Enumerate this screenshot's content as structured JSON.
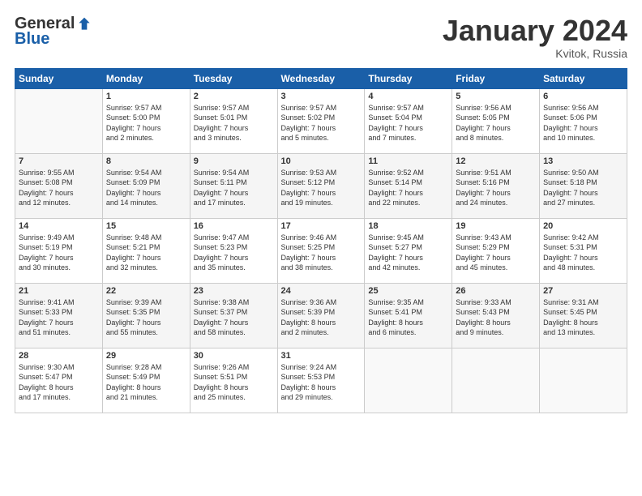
{
  "logo": {
    "general": "General",
    "blue": "Blue"
  },
  "title": {
    "month_year": "January 2024",
    "location": "Kvitok, Russia"
  },
  "headers": [
    "Sunday",
    "Monday",
    "Tuesday",
    "Wednesday",
    "Thursday",
    "Friday",
    "Saturday"
  ],
  "weeks": [
    [
      {
        "day": "",
        "info": ""
      },
      {
        "day": "1",
        "info": "Sunrise: 9:57 AM\nSunset: 5:00 PM\nDaylight: 7 hours\nand 2 minutes."
      },
      {
        "day": "2",
        "info": "Sunrise: 9:57 AM\nSunset: 5:01 PM\nDaylight: 7 hours\nand 3 minutes."
      },
      {
        "day": "3",
        "info": "Sunrise: 9:57 AM\nSunset: 5:02 PM\nDaylight: 7 hours\nand 5 minutes."
      },
      {
        "day": "4",
        "info": "Sunrise: 9:57 AM\nSunset: 5:04 PM\nDaylight: 7 hours\nand 7 minutes."
      },
      {
        "day": "5",
        "info": "Sunrise: 9:56 AM\nSunset: 5:05 PM\nDaylight: 7 hours\nand 8 minutes."
      },
      {
        "day": "6",
        "info": "Sunrise: 9:56 AM\nSunset: 5:06 PM\nDaylight: 7 hours\nand 10 minutes."
      }
    ],
    [
      {
        "day": "7",
        "info": "Sunrise: 9:55 AM\nSunset: 5:08 PM\nDaylight: 7 hours\nand 12 minutes."
      },
      {
        "day": "8",
        "info": "Sunrise: 9:54 AM\nSunset: 5:09 PM\nDaylight: 7 hours\nand 14 minutes."
      },
      {
        "day": "9",
        "info": "Sunrise: 9:54 AM\nSunset: 5:11 PM\nDaylight: 7 hours\nand 17 minutes."
      },
      {
        "day": "10",
        "info": "Sunrise: 9:53 AM\nSunset: 5:12 PM\nDaylight: 7 hours\nand 19 minutes."
      },
      {
        "day": "11",
        "info": "Sunrise: 9:52 AM\nSunset: 5:14 PM\nDaylight: 7 hours\nand 22 minutes."
      },
      {
        "day": "12",
        "info": "Sunrise: 9:51 AM\nSunset: 5:16 PM\nDaylight: 7 hours\nand 24 minutes."
      },
      {
        "day": "13",
        "info": "Sunrise: 9:50 AM\nSunset: 5:18 PM\nDaylight: 7 hours\nand 27 minutes."
      }
    ],
    [
      {
        "day": "14",
        "info": "Sunrise: 9:49 AM\nSunset: 5:19 PM\nDaylight: 7 hours\nand 30 minutes."
      },
      {
        "day": "15",
        "info": "Sunrise: 9:48 AM\nSunset: 5:21 PM\nDaylight: 7 hours\nand 32 minutes."
      },
      {
        "day": "16",
        "info": "Sunrise: 9:47 AM\nSunset: 5:23 PM\nDaylight: 7 hours\nand 35 minutes."
      },
      {
        "day": "17",
        "info": "Sunrise: 9:46 AM\nSunset: 5:25 PM\nDaylight: 7 hours\nand 38 minutes."
      },
      {
        "day": "18",
        "info": "Sunrise: 9:45 AM\nSunset: 5:27 PM\nDaylight: 7 hours\nand 42 minutes."
      },
      {
        "day": "19",
        "info": "Sunrise: 9:43 AM\nSunset: 5:29 PM\nDaylight: 7 hours\nand 45 minutes."
      },
      {
        "day": "20",
        "info": "Sunrise: 9:42 AM\nSunset: 5:31 PM\nDaylight: 7 hours\nand 48 minutes."
      }
    ],
    [
      {
        "day": "21",
        "info": "Sunrise: 9:41 AM\nSunset: 5:33 PM\nDaylight: 7 hours\nand 51 minutes."
      },
      {
        "day": "22",
        "info": "Sunrise: 9:39 AM\nSunset: 5:35 PM\nDaylight: 7 hours\nand 55 minutes."
      },
      {
        "day": "23",
        "info": "Sunrise: 9:38 AM\nSunset: 5:37 PM\nDaylight: 7 hours\nand 58 minutes."
      },
      {
        "day": "24",
        "info": "Sunrise: 9:36 AM\nSunset: 5:39 PM\nDaylight: 8 hours\nand 2 minutes."
      },
      {
        "day": "25",
        "info": "Sunrise: 9:35 AM\nSunset: 5:41 PM\nDaylight: 8 hours\nand 6 minutes."
      },
      {
        "day": "26",
        "info": "Sunrise: 9:33 AM\nSunset: 5:43 PM\nDaylight: 8 hours\nand 9 minutes."
      },
      {
        "day": "27",
        "info": "Sunrise: 9:31 AM\nSunset: 5:45 PM\nDaylight: 8 hours\nand 13 minutes."
      }
    ],
    [
      {
        "day": "28",
        "info": "Sunrise: 9:30 AM\nSunset: 5:47 PM\nDaylight: 8 hours\nand 17 minutes."
      },
      {
        "day": "29",
        "info": "Sunrise: 9:28 AM\nSunset: 5:49 PM\nDaylight: 8 hours\nand 21 minutes."
      },
      {
        "day": "30",
        "info": "Sunrise: 9:26 AM\nSunset: 5:51 PM\nDaylight: 8 hours\nand 25 minutes."
      },
      {
        "day": "31",
        "info": "Sunrise: 9:24 AM\nSunset: 5:53 PM\nDaylight: 8 hours\nand 29 minutes."
      },
      {
        "day": "",
        "info": ""
      },
      {
        "day": "",
        "info": ""
      },
      {
        "day": "",
        "info": ""
      }
    ]
  ]
}
